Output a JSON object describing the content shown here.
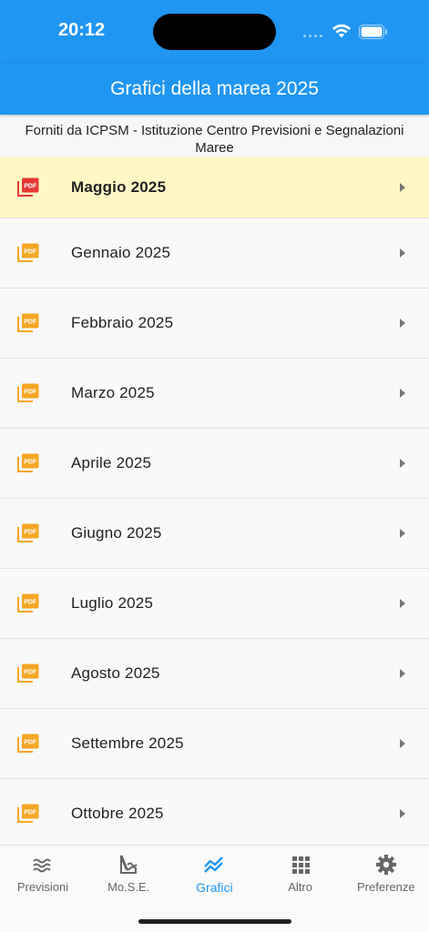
{
  "status": {
    "time": "20:12"
  },
  "header": {
    "title": "Grafici della marea 2025"
  },
  "source_note": "Forniti da ICPSM - Istituzione Centro Previsioni e Segnalazioni Maree",
  "colors": {
    "primary": "#2096f3",
    "highlight": "#fff8c5",
    "pdf_red": "#e53935",
    "pdf_orange": "#f5a623"
  },
  "items": [
    {
      "label": "Maggio 2025",
      "highlight": true,
      "icon": "pdf-icon"
    },
    {
      "label": "Gennaio 2025",
      "icon": "pdf-icon"
    },
    {
      "label": "Febbraio 2025",
      "icon": "pdf-icon"
    },
    {
      "label": "Marzo 2025",
      "icon": "pdf-icon"
    },
    {
      "label": "Aprile 2025",
      "icon": "pdf-icon"
    },
    {
      "label": "Giugno 2025",
      "icon": "pdf-icon"
    },
    {
      "label": "Luglio 2025",
      "icon": "pdf-icon"
    },
    {
      "label": "Agosto 2025",
      "icon": "pdf-icon"
    },
    {
      "label": "Settembre 2025",
      "icon": "pdf-icon"
    },
    {
      "label": "Ottobre 2025",
      "icon": "pdf-icon"
    }
  ],
  "tabs": [
    {
      "label": "Previsioni",
      "icon": "waves-icon"
    },
    {
      "label": "Mo.S.E.",
      "icon": "barrier-icon"
    },
    {
      "label": "Grafici",
      "icon": "chart-icon",
      "active": true
    },
    {
      "label": "Altro",
      "icon": "grid-icon"
    },
    {
      "label": "Preferenze",
      "icon": "gear-icon"
    }
  ]
}
